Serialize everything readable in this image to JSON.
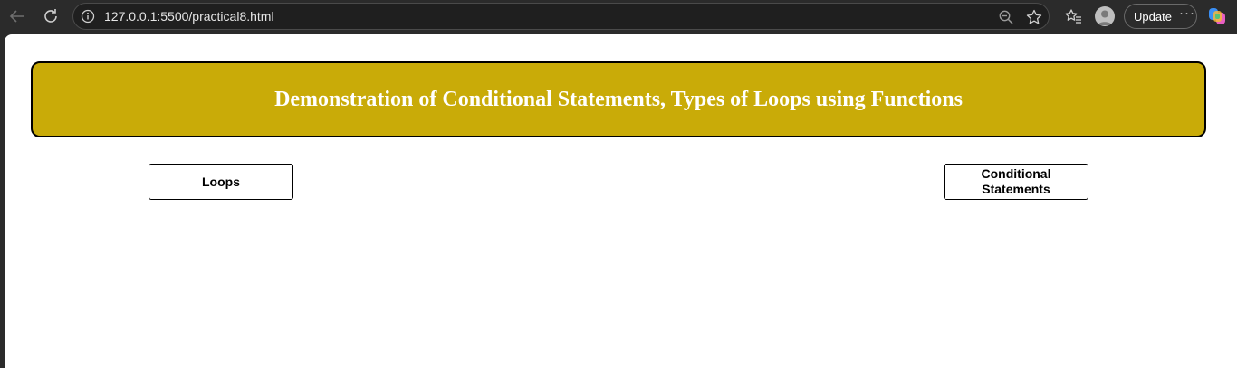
{
  "browser": {
    "url": "127.0.0.1:5500/practical8.html",
    "update_label": "Update",
    "more_label": "···"
  },
  "page": {
    "title": "Demonstration of Conditional Statements, Types of Loops using Functions",
    "buttons": {
      "loops": "Loops",
      "conditional": "Conditional Statements"
    }
  },
  "colors": {
    "header_bg": "#c9ab08",
    "header_text": "#ffffff",
    "chrome_bg": "#2b2b2b"
  },
  "icons": [
    "back-arrow-icon",
    "reload-icon",
    "info-icon",
    "zoom-out-icon",
    "star-icon",
    "favorites-icon",
    "profile-avatar-icon",
    "more-icon",
    "copilot-icon"
  ]
}
